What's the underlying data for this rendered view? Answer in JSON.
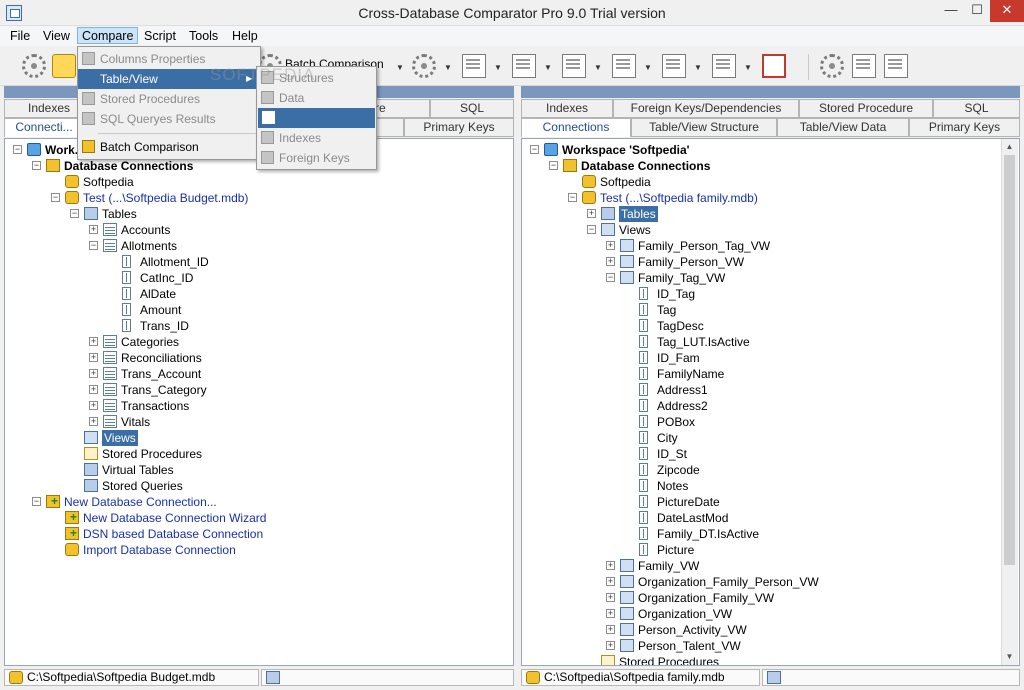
{
  "window": {
    "title": "Cross-Database Comparator Pro 9.0 Trial version",
    "min": "—",
    "max": "☐",
    "close": "✕"
  },
  "menubar": [
    "File",
    "View",
    "Compare",
    "Script",
    "Tools",
    "Help"
  ],
  "toolbar": {
    "batch_label": "Batch Comparison"
  },
  "watermark": "SOFTPEDIA",
  "compare_menu": {
    "items": [
      {
        "label": "Columns Properties",
        "state": "disabled"
      },
      {
        "label": "Table/View",
        "state": "highlighted"
      },
      {
        "label": "Stored Procedures",
        "state": "disabled"
      },
      {
        "label": "SQL Queryes Results",
        "state": "disabled"
      },
      {
        "label": "Batch Comparison",
        "state": "enabled"
      }
    ]
  },
  "tableview_submenu": {
    "items": [
      {
        "label": "Structures",
        "state": "disabled"
      },
      {
        "label": "Data",
        "state": "disabled"
      },
      {
        "label": "",
        "state": "highlighted"
      },
      {
        "label": "Indexes",
        "state": "disabled"
      },
      {
        "label": "Foreign Keys",
        "state": "disabled"
      }
    ]
  },
  "left": {
    "tabs_back": [
      "Indexes",
      "",
      "...ure",
      "SQL"
    ],
    "tabs_front": [
      "Connecti...",
      "",
      "",
      "Primary Keys"
    ],
    "tree": [
      {
        "label": "Work...",
        "level": 0,
        "icon": "ws",
        "exp": "-",
        "bold": true
      },
      {
        "label": "Database Connections",
        "level": 1,
        "icon": "dbgroup",
        "exp": "-",
        "bold": true
      },
      {
        "label": "Softpedia",
        "level": 2,
        "icon": "db",
        "exp": ""
      },
      {
        "label": "Test  (...\\Softpedia Budget.mdb)",
        "level": 2,
        "icon": "db",
        "exp": "-",
        "link": true
      },
      {
        "label": "Tables",
        "level": 3,
        "icon": "tables",
        "exp": "-"
      },
      {
        "label": "Accounts",
        "level": 4,
        "icon": "table",
        "exp": "+"
      },
      {
        "label": "Allotments",
        "level": 4,
        "icon": "table",
        "exp": "-"
      },
      {
        "label": "Allotment_ID",
        "level": 5,
        "icon": "col",
        "exp": ""
      },
      {
        "label": "CatInc_ID",
        "level": 5,
        "icon": "col",
        "exp": ""
      },
      {
        "label": "AlDate",
        "level": 5,
        "icon": "col",
        "exp": ""
      },
      {
        "label": "Amount",
        "level": 5,
        "icon": "col",
        "exp": ""
      },
      {
        "label": "Trans_ID",
        "level": 5,
        "icon": "col",
        "exp": ""
      },
      {
        "label": "Categories",
        "level": 4,
        "icon": "table",
        "exp": "+"
      },
      {
        "label": "Reconciliations",
        "level": 4,
        "icon": "table",
        "exp": "+"
      },
      {
        "label": "Trans_Account",
        "level": 4,
        "icon": "table",
        "exp": "+"
      },
      {
        "label": "Trans_Category",
        "level": 4,
        "icon": "table",
        "exp": "+"
      },
      {
        "label": "Transactions",
        "level": 4,
        "icon": "table",
        "exp": "+"
      },
      {
        "label": "Vitals",
        "level": 4,
        "icon": "table",
        "exp": "+"
      },
      {
        "label": "Views",
        "level": 3,
        "icon": "view",
        "exp": "",
        "hl": true
      },
      {
        "label": "Stored Procedures",
        "level": 3,
        "icon": "proc",
        "exp": ""
      },
      {
        "label": "Virtual Tables",
        "level": 3,
        "icon": "tables",
        "exp": ""
      },
      {
        "label": "Stored Queries",
        "level": 3,
        "icon": "tables",
        "exp": ""
      },
      {
        "label": "New Database Connection...",
        "level": 1,
        "icon": "plus",
        "exp": "-",
        "link": true
      },
      {
        "label": "New Database Connection Wizard",
        "level": 2,
        "icon": "plus",
        "exp": "",
        "link": true
      },
      {
        "label": "DSN based Database Connection",
        "level": 2,
        "icon": "plus",
        "exp": "",
        "link": true
      },
      {
        "label": "Import Database Connection",
        "level": 2,
        "icon": "db",
        "exp": "",
        "link": true
      }
    ],
    "status": "C:\\Softpedia\\Softpedia Budget.mdb"
  },
  "right": {
    "tabs_back": [
      "Indexes",
      "Foreign Keys/Dependencies",
      "Stored Procedure",
      "SQL"
    ],
    "tabs_front": [
      "Connections",
      "Table/View Structure",
      "Table/View Data",
      "Primary Keys"
    ],
    "tree": [
      {
        "label": "Workspace 'Softpedia'",
        "level": 0,
        "icon": "ws",
        "exp": "-",
        "bold": true
      },
      {
        "label": "Database Connections",
        "level": 1,
        "icon": "dbgroup",
        "exp": "-",
        "bold": true
      },
      {
        "label": "Softpedia",
        "level": 2,
        "icon": "db",
        "exp": ""
      },
      {
        "label": "Test  (...\\Softpedia family.mdb)",
        "level": 2,
        "icon": "db",
        "exp": "-",
        "link": true
      },
      {
        "label": "Tables",
        "level": 3,
        "icon": "tables",
        "exp": "+",
        "hl": true
      },
      {
        "label": "Views",
        "level": 3,
        "icon": "view",
        "exp": "-"
      },
      {
        "label": "Family_Person_Tag_VW",
        "level": 4,
        "icon": "view",
        "exp": "+"
      },
      {
        "label": "Family_Person_VW",
        "level": 4,
        "icon": "view",
        "exp": "+"
      },
      {
        "label": "Family_Tag_VW",
        "level": 4,
        "icon": "view",
        "exp": "-"
      },
      {
        "label": "ID_Tag",
        "level": 5,
        "icon": "col",
        "exp": ""
      },
      {
        "label": "Tag",
        "level": 5,
        "icon": "col",
        "exp": ""
      },
      {
        "label": "TagDesc",
        "level": 5,
        "icon": "col",
        "exp": ""
      },
      {
        "label": "Tag_LUT.IsActive",
        "level": 5,
        "icon": "col",
        "exp": ""
      },
      {
        "label": "ID_Fam",
        "level": 5,
        "icon": "col",
        "exp": ""
      },
      {
        "label": "FamilyName",
        "level": 5,
        "icon": "col",
        "exp": ""
      },
      {
        "label": "Address1",
        "level": 5,
        "icon": "col",
        "exp": ""
      },
      {
        "label": "Address2",
        "level": 5,
        "icon": "col",
        "exp": ""
      },
      {
        "label": "POBox",
        "level": 5,
        "icon": "col",
        "exp": ""
      },
      {
        "label": "City",
        "level": 5,
        "icon": "col",
        "exp": ""
      },
      {
        "label": "ID_St",
        "level": 5,
        "icon": "col",
        "exp": ""
      },
      {
        "label": "Zipcode",
        "level": 5,
        "icon": "col",
        "exp": ""
      },
      {
        "label": "Notes",
        "level": 5,
        "icon": "col",
        "exp": ""
      },
      {
        "label": "PictureDate",
        "level": 5,
        "icon": "col",
        "exp": ""
      },
      {
        "label": "DateLastMod",
        "level": 5,
        "icon": "col",
        "exp": ""
      },
      {
        "label": "Family_DT.IsActive",
        "level": 5,
        "icon": "col",
        "exp": ""
      },
      {
        "label": "Picture",
        "level": 5,
        "icon": "col",
        "exp": ""
      },
      {
        "label": "Family_VW",
        "level": 4,
        "icon": "view",
        "exp": "+"
      },
      {
        "label": "Organization_Family_Person_VW",
        "level": 4,
        "icon": "view",
        "exp": "+"
      },
      {
        "label": "Organization_Family_VW",
        "level": 4,
        "icon": "view",
        "exp": "+"
      },
      {
        "label": "Organization_VW",
        "level": 4,
        "icon": "view",
        "exp": "+"
      },
      {
        "label": "Person_Activity_VW",
        "level": 4,
        "icon": "view",
        "exp": "+"
      },
      {
        "label": "Person_Talent_VW",
        "level": 4,
        "icon": "view",
        "exp": "+"
      },
      {
        "label": "Stored Procedures",
        "level": 3,
        "icon": "proc",
        "exp": ""
      }
    ],
    "status": "C:\\Softpedia\\Softpedia family.mdb"
  }
}
